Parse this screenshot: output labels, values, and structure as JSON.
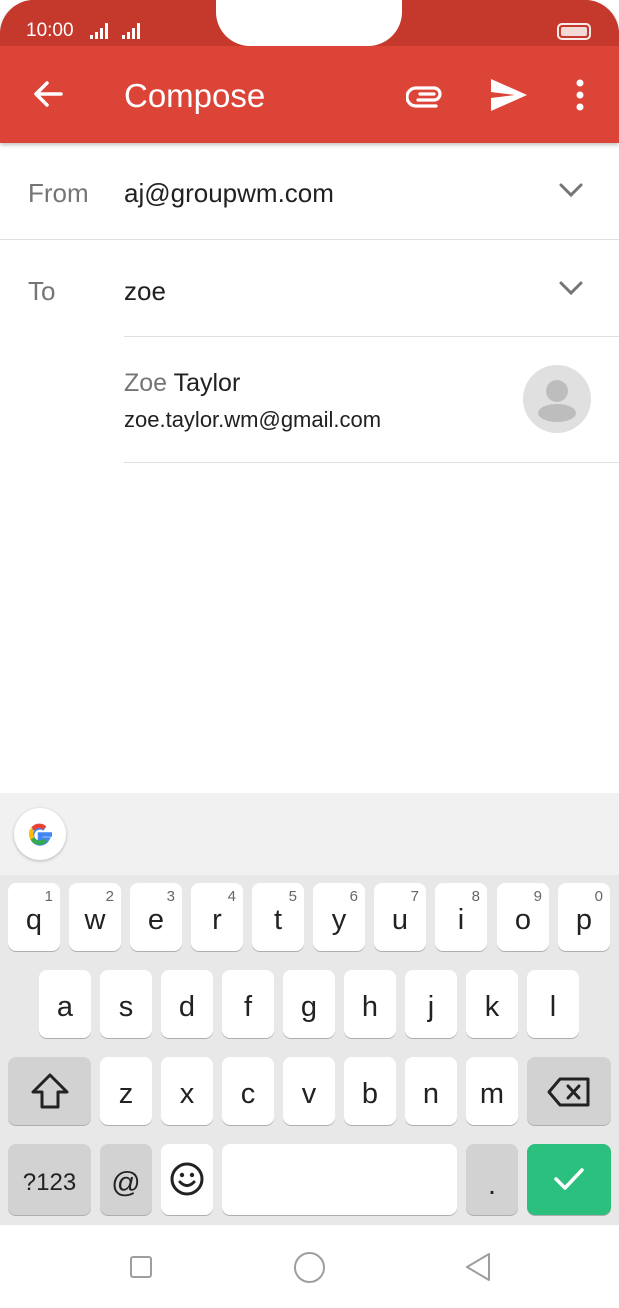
{
  "status": {
    "time": "10:00"
  },
  "appbar": {
    "title": "Compose"
  },
  "from": {
    "label": "From",
    "value": "aj@groupwm.com"
  },
  "to": {
    "label": "To",
    "value": "zoe"
  },
  "suggestion": {
    "name_typed": "Zoe",
    "name_rest": " Taylor",
    "email": "zoe.taylor.wm@gmail.com"
  },
  "keyboard": {
    "row1": [
      {
        "k": "q",
        "h": "1"
      },
      {
        "k": "w",
        "h": "2"
      },
      {
        "k": "e",
        "h": "3"
      },
      {
        "k": "r",
        "h": "4"
      },
      {
        "k": "t",
        "h": "5"
      },
      {
        "k": "y",
        "h": "6"
      },
      {
        "k": "u",
        "h": "7"
      },
      {
        "k": "i",
        "h": "8"
      },
      {
        "k": "o",
        "h": "9"
      },
      {
        "k": "p",
        "h": "0"
      }
    ],
    "row2": [
      "a",
      "s",
      "d",
      "f",
      "g",
      "h",
      "j",
      "k",
      "l"
    ],
    "row3": [
      "z",
      "x",
      "c",
      "v",
      "b",
      "n",
      "m"
    ],
    "symbols_label": "?123",
    "at_label": "@",
    "period_label": "."
  },
  "colors": {
    "accent": "#db4437",
    "enter": "#2bc07d"
  }
}
